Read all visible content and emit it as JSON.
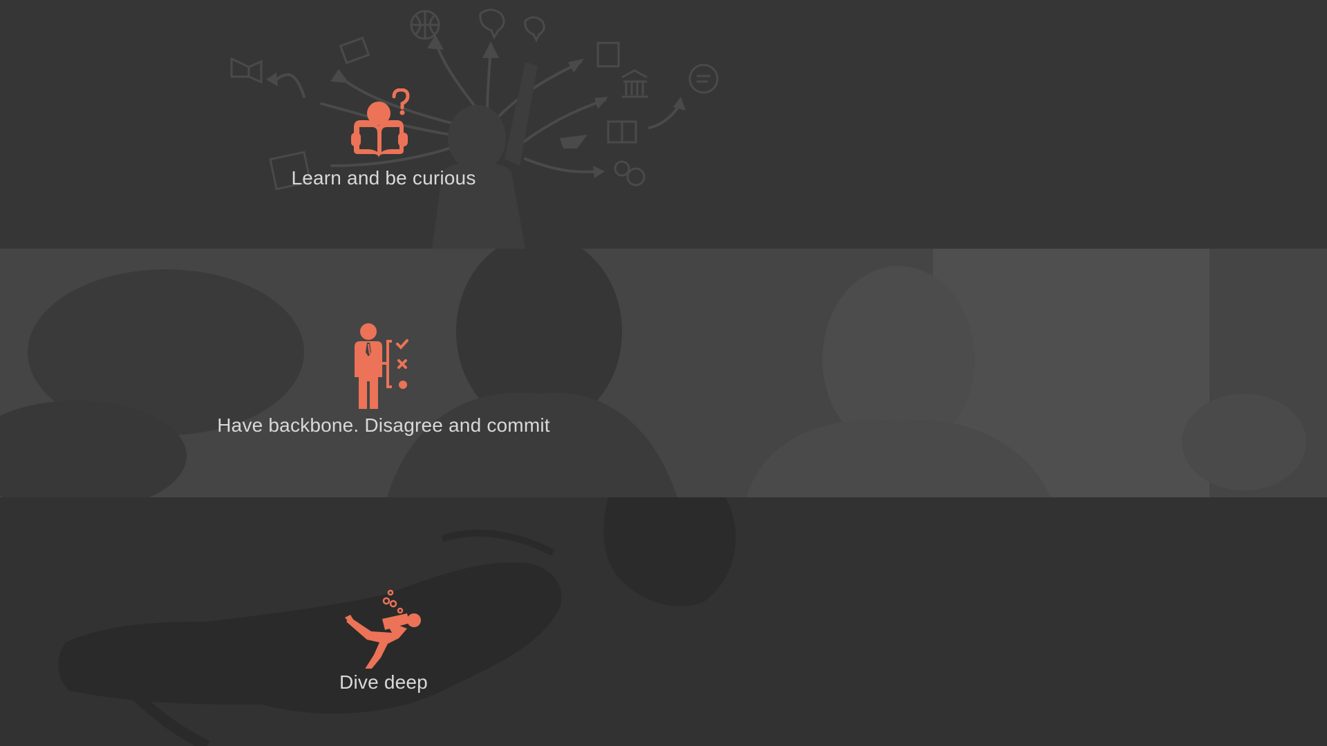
{
  "slide": {
    "accent_color": "#ec7357",
    "text_color": "#d9d9d9",
    "items": [
      {
        "icon": "reader-question-icon",
        "label": "Learn and be curious"
      },
      {
        "icon": "person-decision-icon",
        "label": "Have backbone. Disagree and commit"
      },
      {
        "icon": "scuba-diver-icon",
        "label": "Dive deep"
      }
    ]
  }
}
